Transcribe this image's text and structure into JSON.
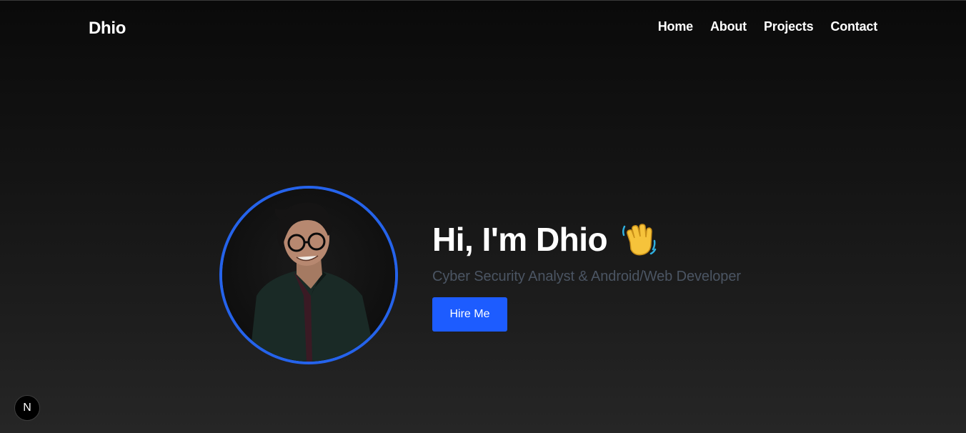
{
  "header": {
    "brand": "Dhio",
    "nav": [
      {
        "label": "Home"
      },
      {
        "label": "About"
      },
      {
        "label": "Projects"
      },
      {
        "label": "Contact"
      }
    ]
  },
  "hero": {
    "greeting": "Hi, I'm Dhio",
    "greeting_icon": "waving-hand-icon",
    "subtitle": "Cyber Security Analyst & Android/Web Developer",
    "cta_label": "Hire Me"
  },
  "dev_badge": {
    "icon": "nextjs-n-icon",
    "letter": "N"
  },
  "colors": {
    "accent": "#1d5cff",
    "ring": "#2563eb",
    "subtitle": "#4b5563"
  }
}
